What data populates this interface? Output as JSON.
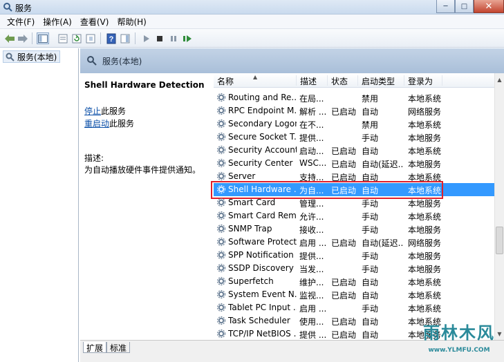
{
  "window": {
    "title": "服务"
  },
  "menu": [
    "文件(F)",
    "操作(A)",
    "查看(V)",
    "帮助(H)"
  ],
  "tree": {
    "root": "服务(本地)"
  },
  "header": {
    "title": "服务(本地)"
  },
  "details": {
    "service_name": "Shell Hardware Detection",
    "stop_link": "停止",
    "stop_suffix": "此服务",
    "restart_link": "重启动",
    "restart_suffix": "此服务",
    "desc_label": "描述:",
    "desc_text": "为自动播放硬件事件提供通知。"
  },
  "columns": [
    "名称",
    "描述",
    "状态",
    "启动类型",
    "登录为"
  ],
  "services": [
    {
      "name": "Routing and Re...",
      "desc": "在局...",
      "status": "",
      "startup": "禁用",
      "logon": "本地系统"
    },
    {
      "name": "RPC Endpoint M...",
      "desc": "解析 ...",
      "status": "已启动",
      "startup": "自动",
      "logon": "网络服务"
    },
    {
      "name": "Secondary Logon",
      "desc": "在不...",
      "status": "",
      "startup": "禁用",
      "logon": "本地系统"
    },
    {
      "name": "Secure Socket T...",
      "desc": "提供...",
      "status": "",
      "startup": "手动",
      "logon": "本地服务"
    },
    {
      "name": "Security Account...",
      "desc": "启动...",
      "status": "已启动",
      "startup": "自动",
      "logon": "本地系统"
    },
    {
      "name": "Security Center",
      "desc": "WSC...",
      "status": "已启动",
      "startup": "自动(延迟...",
      "logon": "本地服务"
    },
    {
      "name": "Server",
      "desc": "支持...",
      "status": "已启动",
      "startup": "自动",
      "logon": "本地系统"
    },
    {
      "name": "Shell Hardware ...",
      "desc": "为自...",
      "status": "已启动",
      "startup": "自动",
      "logon": "本地系统",
      "selected": true
    },
    {
      "name": "Smart Card",
      "desc": "管理...",
      "status": "",
      "startup": "手动",
      "logon": "本地服务"
    },
    {
      "name": "Smart Card Rem...",
      "desc": "允许...",
      "status": "",
      "startup": "手动",
      "logon": "本地系统"
    },
    {
      "name": "SNMP Trap",
      "desc": "接收...",
      "status": "",
      "startup": "手动",
      "logon": "本地服务"
    },
    {
      "name": "Software Protect...",
      "desc": "启用 ...",
      "status": "已启动",
      "startup": "自动(延迟...",
      "logon": "网络服务"
    },
    {
      "name": "SPP Notification ...",
      "desc": "提供...",
      "status": "",
      "startup": "手动",
      "logon": "本地服务"
    },
    {
      "name": "SSDP Discovery",
      "desc": "当发...",
      "status": "",
      "startup": "手动",
      "logon": "本地服务"
    },
    {
      "name": "Superfetch",
      "desc": "维护...",
      "status": "已启动",
      "startup": "自动",
      "logon": "本地系统"
    },
    {
      "name": "System Event N...",
      "desc": "监视...",
      "status": "已启动",
      "startup": "自动",
      "logon": "本地系统"
    },
    {
      "name": "Tablet PC Input ...",
      "desc": "启用 ...",
      "status": "",
      "startup": "手动",
      "logon": "本地系统"
    },
    {
      "name": "Task Scheduler",
      "desc": "使用...",
      "status": "已启动",
      "startup": "自动",
      "logon": "本地系统"
    },
    {
      "name": "TCP/IP NetBIOS ...",
      "desc": "提供 ...",
      "status": "已启动",
      "startup": "自动",
      "logon": "本地服务"
    }
  ],
  "tabs": [
    "扩展",
    "标准"
  ],
  "watermark": {
    "text": "雨林木风",
    "url": "www.YLMFU.COM"
  },
  "colors": {
    "selection": "#3399ff",
    "highlight_box": "#e0202a",
    "link": "#0b4fa8"
  }
}
